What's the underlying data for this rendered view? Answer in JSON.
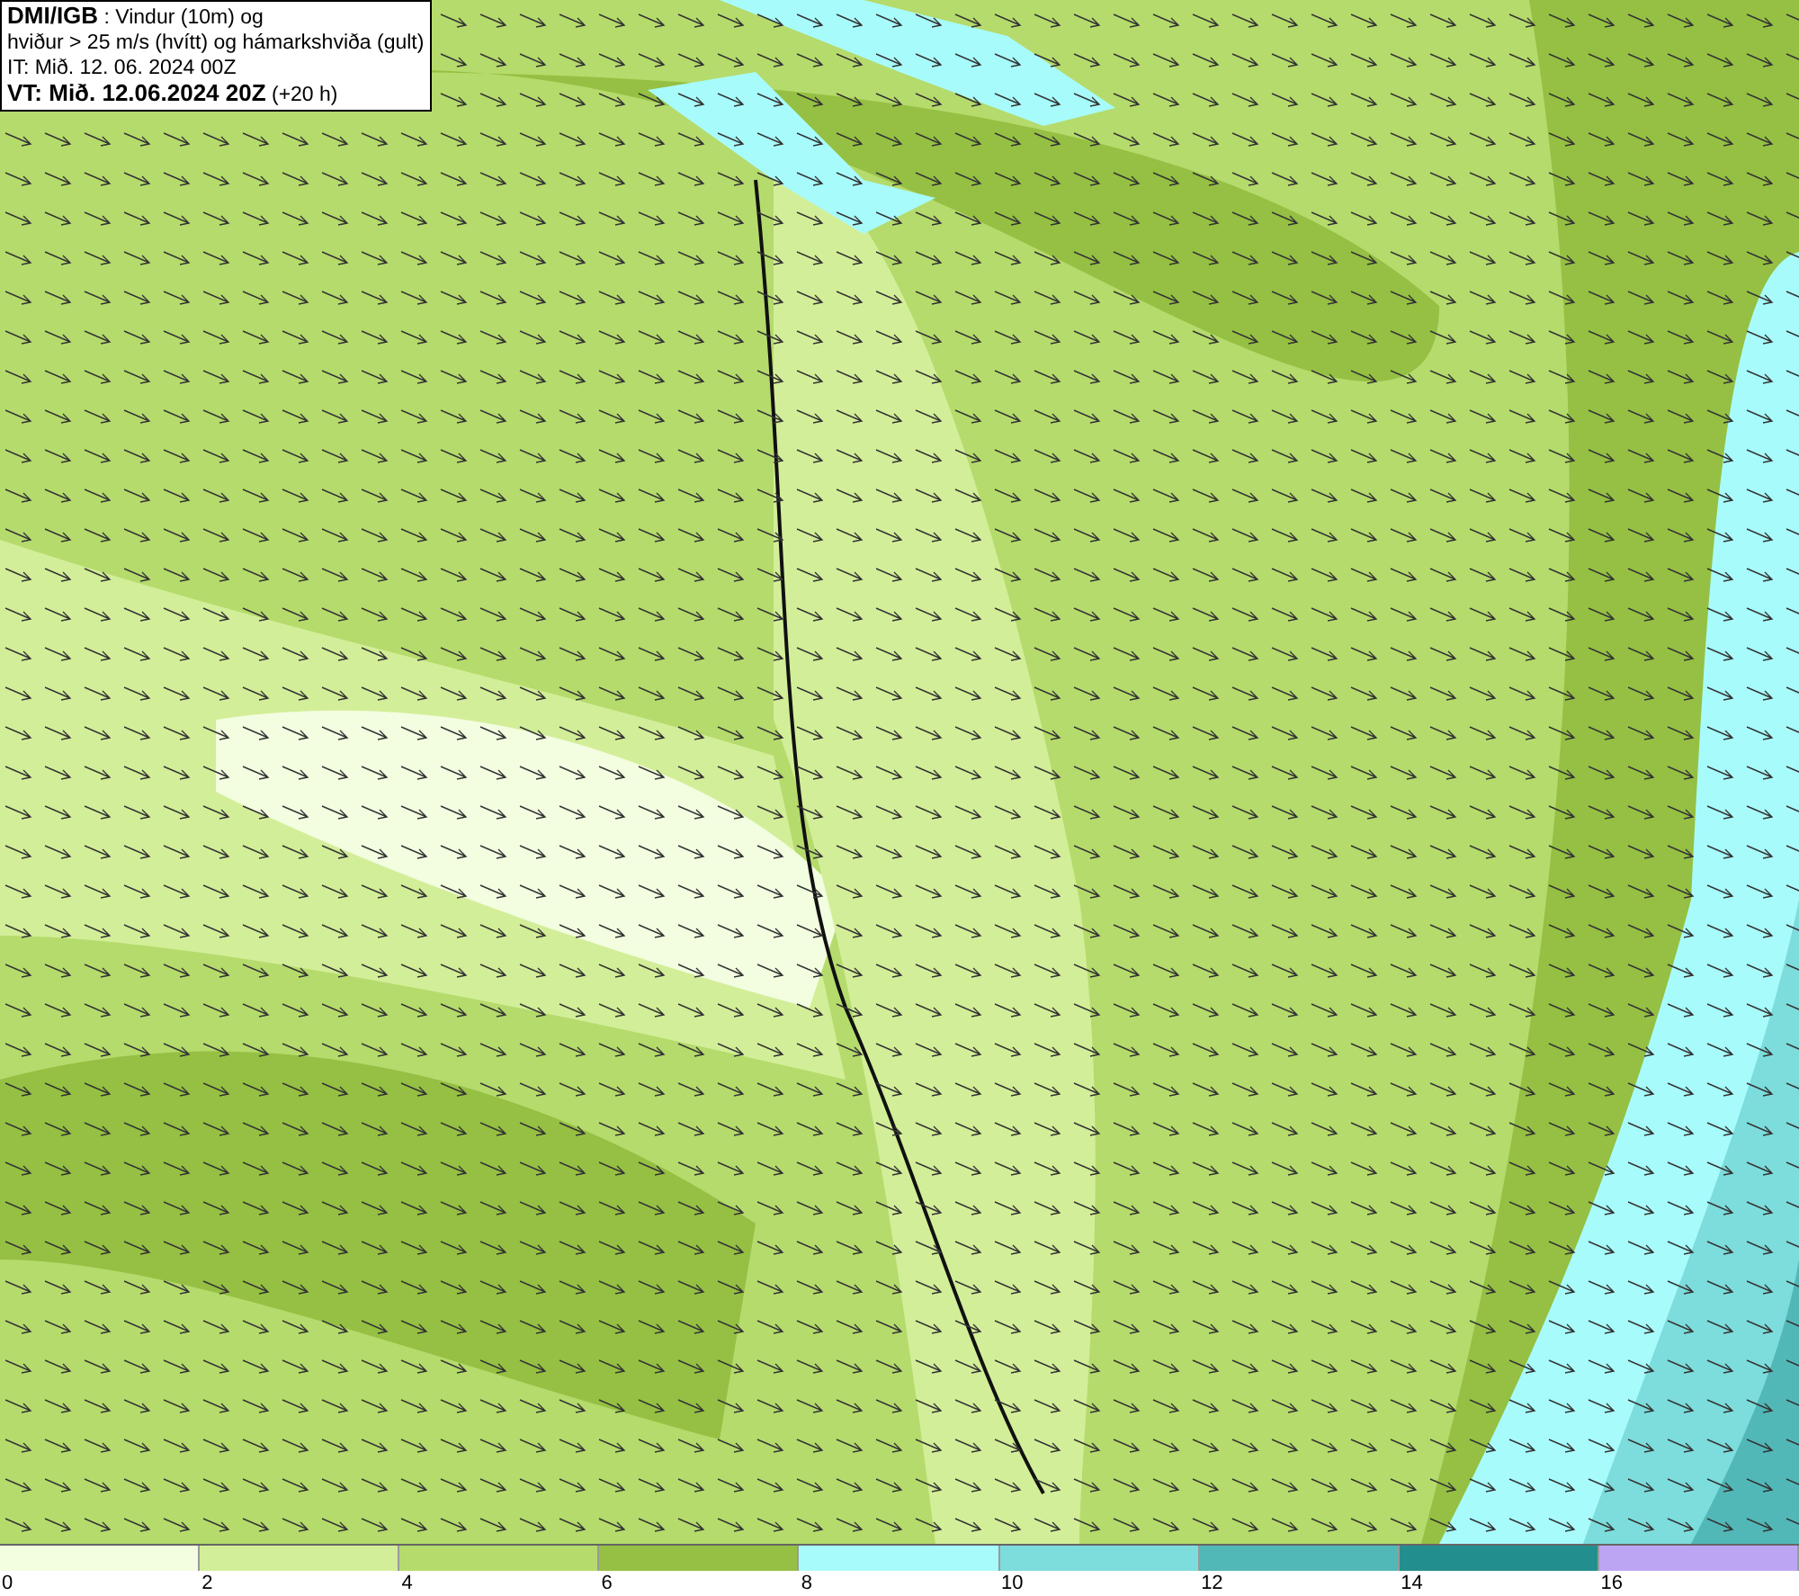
{
  "header": {
    "lines": [
      "**DMI/IGB** : Vindur (10m) og",
      "hviður > 25 m/s (hvítt) og hámarkshviða (gult)",
      "IT: Mið. 12. 06. 2024 00Z",
      "**VT: Mið. 12.06.2024 20Z** (+20 h)"
    ]
  },
  "legend": {
    "bins": [
      {
        "color": "#f3fde0"
      },
      {
        "color": "#d3ee98"
      },
      {
        "color": "#b5db6c"
      },
      {
        "color": "#95c043"
      },
      {
        "color": "#a8fbfb"
      },
      {
        "color": "#7ddcdc"
      },
      {
        "color": "#52b7b7"
      },
      {
        "color": "#238e8e"
      },
      {
        "color": "#bca6f4"
      }
    ],
    "ticks": [
      "0",
      "2",
      "4",
      "6",
      "8",
      "10",
      "12",
      "14",
      "16"
    ]
  }
}
